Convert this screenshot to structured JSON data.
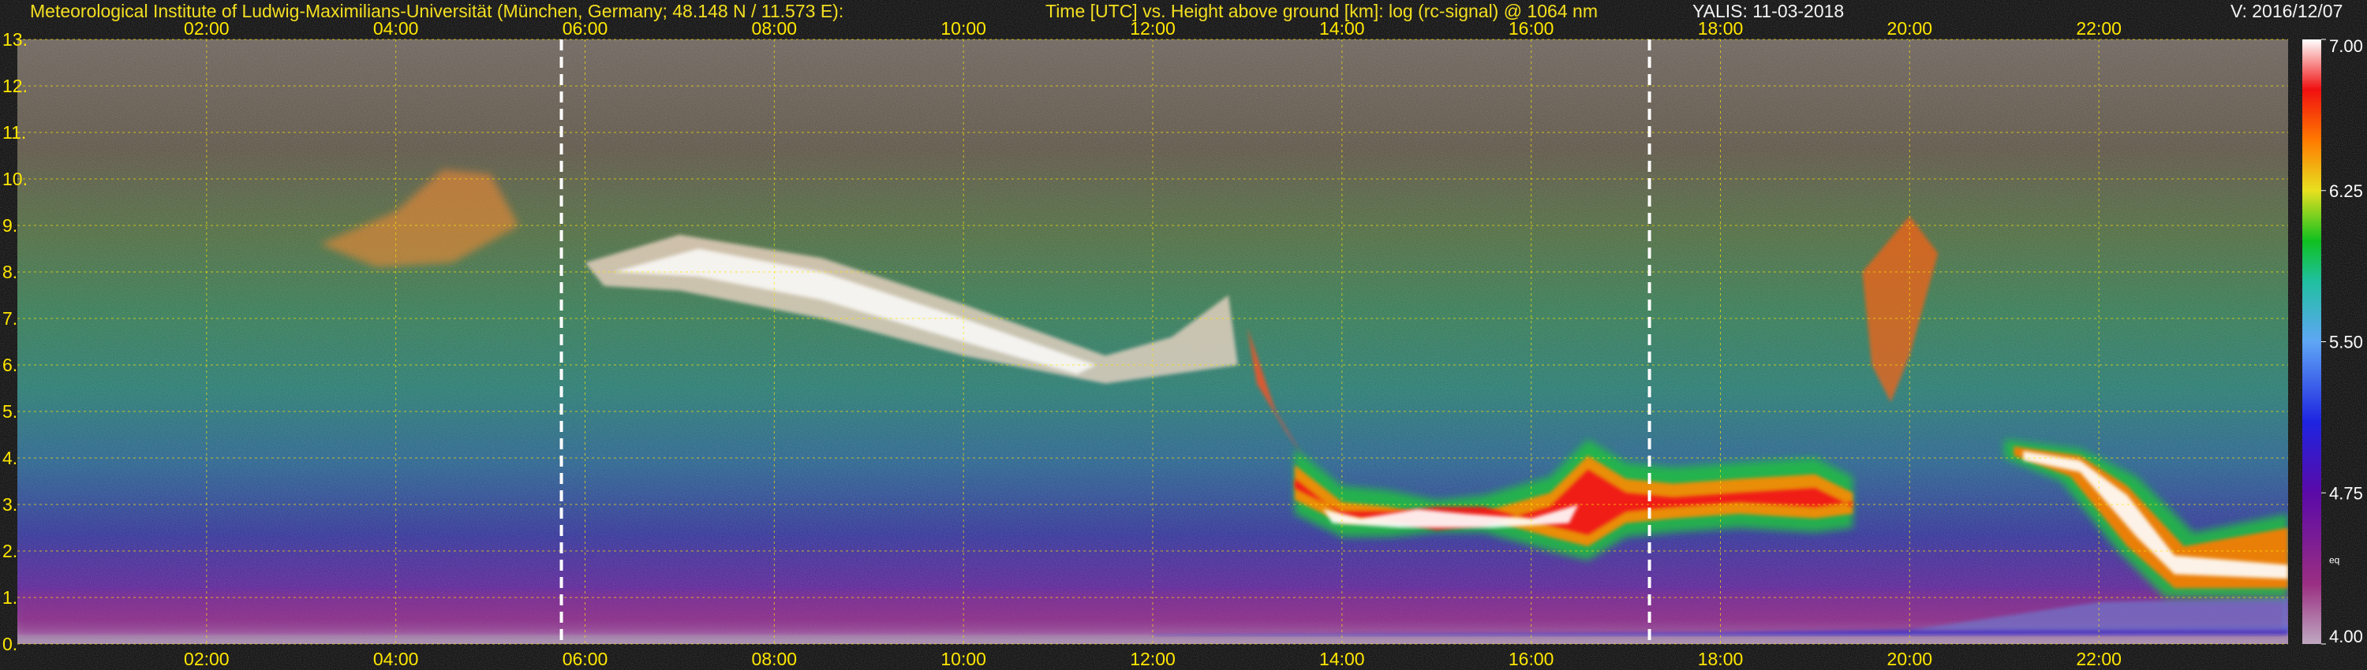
{
  "header": {
    "institute": "Meteorological Institute of Ludwig-Maximilians-Universität (München, Germany; 48.148 N / 11.573 E):",
    "description": "Time [UTC] vs. Height above ground [km]: log (rc-signal) @ 1064 nm",
    "station_date": "YALIS: 11-03-2018",
    "version": "V: 2016/12/07"
  },
  "colors": {
    "background": "#000000",
    "tick_text": "#ffe600",
    "gridline": "#ffe600",
    "marker_line": "#ffffff"
  },
  "chart_data": {
    "type": "heatmap",
    "title": "Time [UTC] vs. Height above ground [km]: log (rc-signal) @ 1064 nm",
    "x_range_hours": [
      0.0,
      24.0
    ],
    "x_ticks": [
      "02:00",
      "04:00",
      "06:00",
      "08:00",
      "10:00",
      "12:00",
      "14:00",
      "16:00",
      "18:00",
      "20:00",
      "22:00"
    ],
    "x_tick_hours": [
      2,
      4,
      6,
      8,
      10,
      12,
      14,
      16,
      18,
      20,
      22
    ],
    "y_range_km": [
      0,
      13
    ],
    "y_ticks": [
      "0.",
      "1.",
      "2.",
      "3.",
      "4.",
      "5.",
      "6.",
      "7.",
      "8.",
      "9.",
      "10.",
      "11.",
      "12.",
      "13."
    ],
    "y_tick_values": [
      0,
      1,
      2,
      3,
      4,
      5,
      6,
      7,
      8,
      9,
      10,
      11,
      12,
      13
    ],
    "grid": true,
    "vertical_markers_hours": [
      5.75,
      17.25
    ],
    "colorbar": {
      "range": [
        4.0,
        7.0
      ],
      "ticks": [
        "4.00",
        "4.75",
        "5.50",
        "6.25",
        "7.00"
      ],
      "tick_values": [
        4.0,
        4.75,
        5.5,
        6.25,
        7.0
      ],
      "small_label": "eq",
      "stops": [
        {
          "value": 4.0,
          "color": "#bfa8c0"
        },
        {
          "value": 4.3,
          "color": "#9a2e82"
        },
        {
          "value": 4.75,
          "color": "#5a0aa8"
        },
        {
          "value": 5.1,
          "color": "#1e24e0"
        },
        {
          "value": 5.5,
          "color": "#5fa6f5"
        },
        {
          "value": 5.8,
          "color": "#20c0a0"
        },
        {
          "value": 6.0,
          "color": "#10c020"
        },
        {
          "value": 6.25,
          "color": "#e8e020"
        },
        {
          "value": 6.5,
          "color": "#ff7a00"
        },
        {
          "value": 6.75,
          "color": "#f01010"
        },
        {
          "value": 7.0,
          "color": "#ffffff"
        }
      ]
    },
    "features": [
      {
        "name": "boundary layer",
        "time_hours": [
          0.0,
          24.0
        ],
        "height_km": [
          0.0,
          1.0
        ]
      },
      {
        "name": "cirrus band",
        "time_hours": [
          3.2,
          13.0
        ],
        "height_km": [
          5.5,
          10.2
        ]
      },
      {
        "name": "mid cloud layer",
        "time_hours": [
          13.5,
          19.4
        ],
        "height_km": [
          2.0,
          4.5
        ]
      },
      {
        "name": "late cloud",
        "time_hours": [
          19.3,
          24.0
        ],
        "height_km": [
          1.0,
          4.4
        ]
      }
    ]
  }
}
